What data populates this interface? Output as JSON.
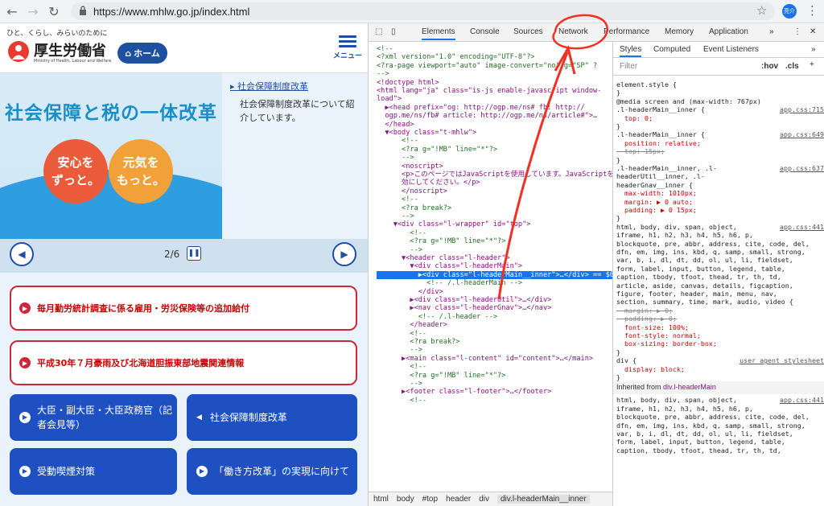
{
  "browser": {
    "url": "https://www.mhlw.go.jp/index.html",
    "avatar_text": "亮介"
  },
  "site": {
    "tagline": "ひと、くらし、みらいのために",
    "logo_text": "厚生労働省",
    "logo_sub": "Ministry of Health, Labour and Welfare",
    "home_label": "ホーム",
    "menu_label": "メニュー",
    "hero_title": "社会保障と税の一体改革",
    "circle1": "安心を\nずっと。",
    "circle2": "元気を\nもっと。",
    "side_link": "社会保障制度改革",
    "side_desc": "社会保障制度改革について紹介しています。",
    "pager_count": "2/6",
    "alerts": [
      "毎月勤労統計調査に係る雇用・労災保険等の追加給付",
      "平成30年７月豪雨及び北海道胆振東部地震関連情報"
    ],
    "buttons": [
      "大臣・副大臣・大臣政務官（記者会見等）",
      "社会保障制度改革",
      "受動喫煙対策",
      "「働き方改革」の実現に向けて"
    ]
  },
  "devtools": {
    "tabs": [
      "Elements",
      "Console",
      "Sources",
      "Network",
      "Performance",
      "Memory",
      "Application"
    ],
    "active_tab": "Elements",
    "style_tabs": [
      "Styles",
      "Computed",
      "Event Listeners"
    ],
    "filter_placeholder": "Filter",
    "filter_hov": ":hov",
    "filter_cls": ".cls",
    "breadcrumbs": [
      "html",
      "body",
      "#top",
      "header",
      "div",
      "div.l-headerMain__inner"
    ],
    "element_lines": [
      "<!--",
      "<?xml version=\"1.0\" encoding=\"UTF-8\"?>",
      "<?ra-page viewport=\"auto\" image-convert=\"no\" g=\"SP\" ?",
      "-->",
      "<!doctype html>",
      "<html lang=\"ja\" class=\"is-js enable-javascript window-",
      "load\">",
      "  ▶<head prefix=\"og: http://ogp.me/ns# fb: http://",
      "  ogp.me/ns/fb# article: http://ogp.me/ns/article#\">…",
      "  </head>",
      "  ▼<body class=\"t-mhlw\">",
      "      <!--",
      "      <?ra g=\"!MB\" line=\"*\"?>",
      "      -->",
      "      <noscript>",
      "      <p>このページではJavaScriptを使用しています。JavaScriptを有",
      "      効にしてください。</p>",
      "      </noscript>",
      "      <!--",
      "      <?ra break?>",
      "      -->",
      "    ▼<div class=\"l-wrapper\" id=\"top\">",
      "        <!--",
      "        <?ra g=\"!MB\" line=\"*\"?>",
      "        -->",
      "      ▼<header class=\"l-header\">",
      "        ▼<div class=\"l-headerMain\">",
      "          ▶<div class=\"l-headerMain__inner\">…</div> == $0",
      "            <!-- /.l-headerMain -->",
      "          </div>",
      "        ▶<div class=\"l-headerUtil\">…</div>",
      "        ▶<nav class=\"l-headerGnav\">…</nav>",
      "          <!-- /.l-header -->",
      "        </header>",
      "        <!--",
      "        <?ra break?>",
      "        -->",
      "      ▶<main class=\"l-content\" id=\"content\">…</main>",
      "        <!--",
      "        <?ra g=\"!MB\" line=\"*\"?>",
      "        -->",
      "      ▶<footer class=\"l-footer\">…</footer>",
      "        <!--"
    ],
    "style_lines": [
      "element.style {",
      "}",
      "@media screen and (max-width: 767px)",
      ".l-headerMain__inner {",
      "  top: 0;",
      "}",
      ".l-headerMain__inner {",
      "  position: relative;",
      "  top: 15px;",
      "}",
      ".l-headerMain__inner, .l-",
      "headerUtil__inner, .l-",
      "headerGnav__inner {",
      "  max-width: 1010px;",
      "  margin: ▶ 0 auto;",
      "  padding: ▶ 0 15px;",
      "}",
      "html, body, div, span, object,",
      "iframe, h1, h2, h3, h4, h5, h6, p,",
      "blockquote, pre, abbr, address, cite, code, del,",
      "dfn, em, img, ins, kbd, q, samp, small, strong,",
      "var, b, i, dl, dt, dd, ol, ul, li, fieldset,",
      "form, label, input, button, legend, table,",
      "caption, tbody, tfoot, thead, tr, th, td,",
      "article, aside, canvas, details, figcaption,",
      "figure, footer, header, main, menu, nav,",
      "section, summary, time, mark, audio, video {",
      "  margin: ▶ 0;",
      "  padding: ▶ 0;",
      "  font-size: 100%;",
      "  font-style: normal;",
      "  box-sizing: border-box;",
      "}",
      "div {",
      "  display: block;",
      "}",
      "html, body, div, span, object,",
      "iframe, h1, h2, h3, h4, h5, h6, p,",
      "blockquote, pre, abbr, address, cite, code, del,",
      "dfn, em, img, ins, kbd, q, samp, small, strong,",
      "var, b, i, dl, dt, dd, ol, ul, li, fieldset,",
      "form, label, input, button, legend, table,",
      "caption, tbody, tfoot, thead, tr, th, td,"
    ],
    "sources": [
      "app.css:715",
      "app.css:649",
      "app.css:637",
      "app.css:441",
      "user agent stylesheet",
      "app.css:441"
    ],
    "inherited_label": "Inherited from",
    "inherited_from": "div.l-headerMain"
  }
}
